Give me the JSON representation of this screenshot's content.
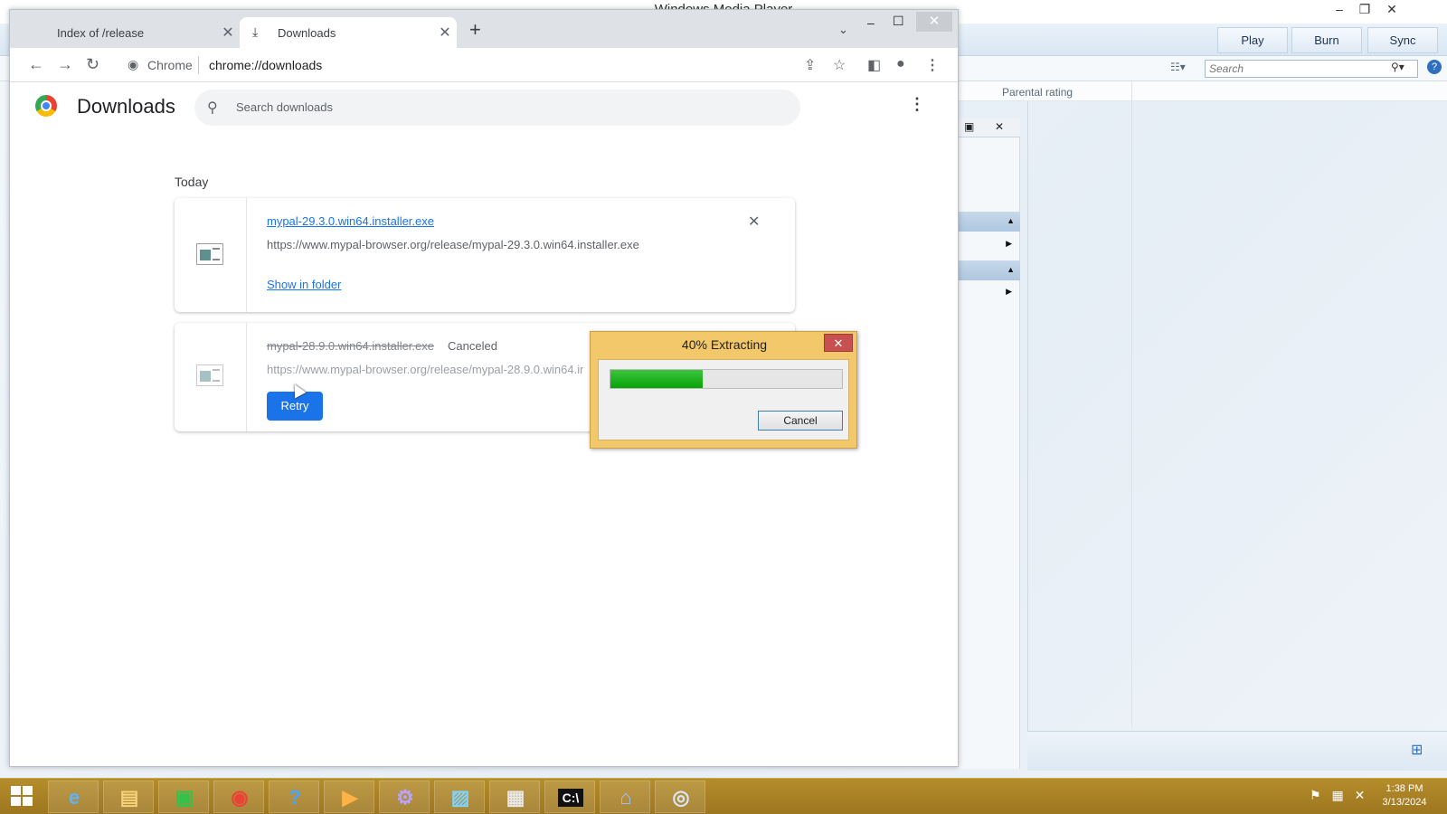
{
  "background_app": {
    "title": "Windows Media Player",
    "toolbar_tabs": [
      "Play",
      "Burn",
      "Sync"
    ],
    "search_placeholder": "Search",
    "column_header": "Parental rating"
  },
  "chrome": {
    "tabs": [
      {
        "label": "Index of /release",
        "active": false
      },
      {
        "label": "Downloads",
        "active": true
      }
    ],
    "omnibox": {
      "site_label": "Chrome",
      "url": "chrome://downloads"
    }
  },
  "downloads_page": {
    "title": "Downloads",
    "search_placeholder": "Search downloads",
    "section_label": "Today",
    "items": [
      {
        "filename": "mypal-29.3.0.win64.installer.exe",
        "url": "https://www.mypal-browser.org/release/mypal-29.3.0.win64.installer.exe",
        "action": "Show in folder"
      },
      {
        "filename": "mypal-28.9.0.win64.installer.exe",
        "status": "Canceled",
        "url": "https://www.mypal-browser.org/release/mypal-28.9.0.win64.installer.exe",
        "action": "Retry"
      }
    ]
  },
  "extract_dialog": {
    "title": "40% Extracting",
    "progress_percent": 40,
    "cancel_label": "Cancel",
    "progress_color": "#06a406",
    "frame_color": "#f2c86b"
  },
  "taskbar": {
    "time": "1:38 PM",
    "date": "3/13/2024",
    "pinned_icons": [
      "internet-explorer-icon",
      "file-explorer-icon",
      "store-icon",
      "chrome-icon",
      "help-icon",
      "media-player-icon",
      "settings-icon",
      "photo-icon",
      "task-manager-icon",
      "command-prompt-icon",
      "network-icon",
      "disc-icon"
    ]
  }
}
